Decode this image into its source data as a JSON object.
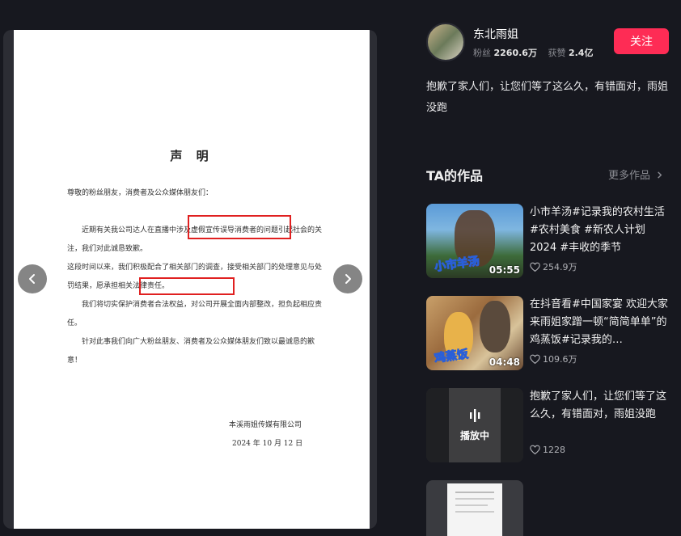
{
  "document": {
    "title": "声 明",
    "salutation": "尊敬的粉丝朋友，消费者及公众媒体朋友们：",
    "para1": "近期有关我公司达人在直播中涉及虚假宣传误导消费者的问题引起社会的关注，我们对此诚恳致歉。",
    "para2": "这段时间以来，我们积极配合了相关部门的调查，接受相关部门的处理意见与处罚结果，愿承担相关法律责任。",
    "para3": "我们将切实保护消费者合法权益，对公司开展全面内部整改，担负起相应责任。",
    "para4": "针对此事我们向广大粉丝朋友、消费者及公众媒体朋友们致以最诚恳的歉意！",
    "company": "本溪雨姐传媒有限公司",
    "date": "2024 年 10 月 12 日"
  },
  "author": {
    "name": "东北雨姐",
    "fans_label": "粉丝",
    "fans_value": "2260.6万",
    "likes_label": "获赞",
    "likes_value": "2.4亿",
    "follow_label": "关注"
  },
  "post": {
    "description": "抱歉了家人们，让您们等了这么久，有错面对，雨姐没跑"
  },
  "works_section": {
    "title": "TA的作品",
    "more_label": "更多作品"
  },
  "works": [
    {
      "title": "小市羊汤#记录我的农村生活 #农村美食 #新农人计划2024 #丰收的季节",
      "duration": "05:55",
      "likes": "254.9万",
      "overlay_caption": "小市羊汤"
    },
    {
      "title": "在抖音看#中国家宴 欢迎大家来雨姐家蹭一顿“简简单单”的鸡蒸饭#记录我的…",
      "duration": "04:48",
      "likes": "109.6万",
      "overlay_caption": "鸡蒸饭"
    },
    {
      "title": "抱歉了家人们，让您们等了这么久，有错面对，雨姐没跑",
      "status": "播放中",
      "likes": "1228"
    }
  ],
  "colors": {
    "accent": "#fe2c55",
    "background": "#17181f",
    "highlight_box": "#e02020"
  },
  "icons": [
    "chevron-left-icon",
    "chevron-right-icon",
    "heart-icon",
    "chevron-right-small-icon",
    "playing-bars-icon"
  ]
}
